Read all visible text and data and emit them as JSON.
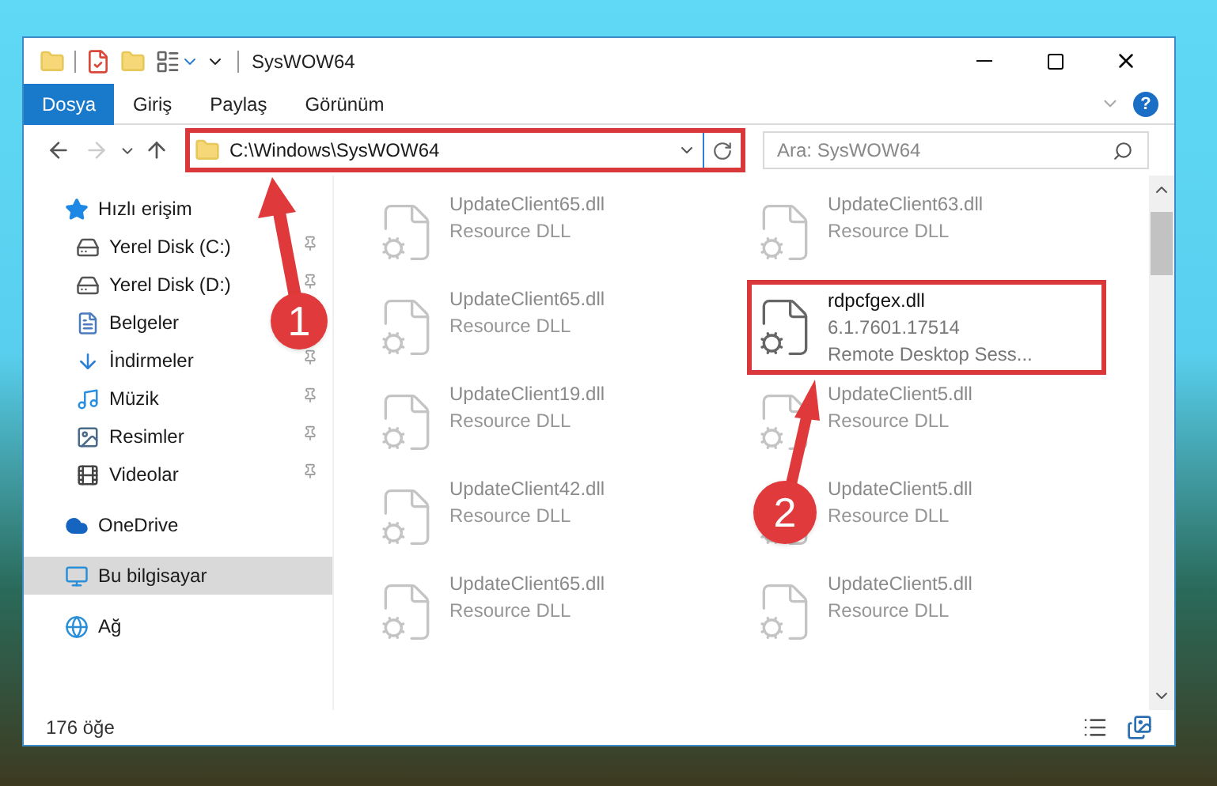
{
  "window": {
    "title": "SysWOW64"
  },
  "ribbon": {
    "tabs": [
      {
        "label": "Dosya",
        "kind": "file_menu"
      },
      {
        "label": "Giriş",
        "kind": "tab"
      },
      {
        "label": "Paylaş",
        "kind": "tab"
      },
      {
        "label": "Görünüm",
        "kind": "tab"
      }
    ],
    "help": "?"
  },
  "nav": [
    {
      "kind": "back",
      "disabled": false
    },
    {
      "kind": "forward",
      "disabled": true
    },
    {
      "kind": "recent",
      "disabled": false
    },
    {
      "kind": "up",
      "disabled": false
    }
  ],
  "address": {
    "path": "C:\\Windows\\SysWOW64",
    "highlighted": true
  },
  "search": {
    "placeholder": "Ara: SysWOW64"
  },
  "sidebar": [
    {
      "label": "Hızlı erişim",
      "kind": "quick",
      "selected": false,
      "children": [
        {
          "label": "Yerel Disk (C:)",
          "kind": "system_disk",
          "pinned": true
        },
        {
          "label": "Yerel Disk (D:)",
          "kind": "disk",
          "pinned": true
        },
        {
          "label": "Belgeler",
          "kind": "documents",
          "pinned": false
        },
        {
          "label": "İndirmeler",
          "kind": "downloads",
          "pinned": true
        },
        {
          "label": "Müzik",
          "kind": "music",
          "pinned": true
        },
        {
          "label": "Resimler",
          "kind": "pictures",
          "pinned": true
        },
        {
          "label": "Videolar",
          "kind": "videos",
          "pinned": true
        }
      ]
    },
    {
      "label": "OneDrive",
      "kind": "cloud",
      "selected": false
    },
    {
      "label": "Bu bilgisayar",
      "kind": "computer",
      "selected": true
    },
    {
      "label": "Ağ",
      "kind": "network",
      "selected": false
    }
  ],
  "files": [
    {
      "name": "UpdateClient65.dll",
      "details": [
        "Resource DLL"
      ],
      "highlighted": false
    },
    {
      "name": "UpdateClient63.dll",
      "details": [
        "Resource DLL"
      ],
      "highlighted": false
    },
    {
      "name": "UpdateClient65.dll",
      "details": [
        "Resource DLL"
      ],
      "highlighted": false
    },
    {
      "name": "rdpcfgex.dll",
      "details": [
        "6.1.7601.17514",
        "Remote Desktop Sess..."
      ],
      "highlighted": true
    },
    {
      "name": "UpdateClient19.dll",
      "details": [
        "Resource DLL"
      ],
      "highlighted": false
    },
    {
      "name": "UpdateClient5.dll",
      "details": [
        "Resource DLL"
      ],
      "highlighted": false
    },
    {
      "name": "UpdateClient42.dll",
      "details": [
        "Resource DLL"
      ],
      "highlighted": false
    },
    {
      "name": "UpdateClient5.dll",
      "details": [
        "Resource DLL"
      ],
      "highlighted": false
    },
    {
      "name": "UpdateClient65.dll",
      "details": [
        "Resource DLL"
      ],
      "highlighted": false
    },
    {
      "name": "UpdateClient5.dll",
      "details": [
        "Resource DLL"
      ],
      "highlighted": false
    }
  ],
  "status_bar": {
    "item_count": "176 öğe"
  },
  "annotations": [
    {
      "number": "1"
    },
    {
      "number": "2"
    }
  ]
}
